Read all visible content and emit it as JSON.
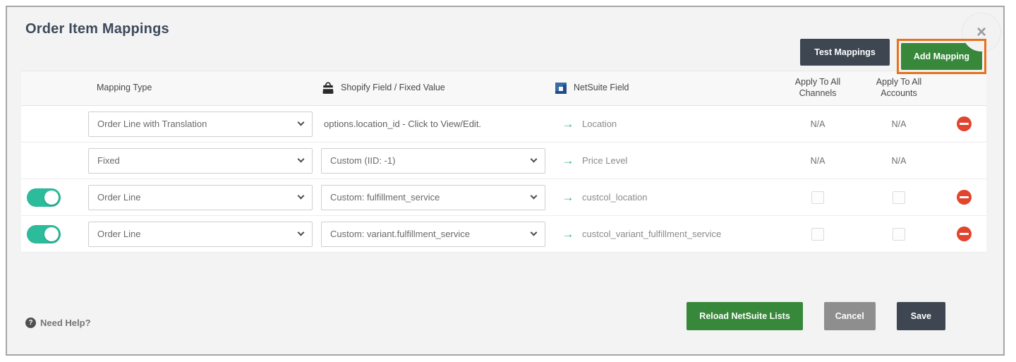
{
  "panel": {
    "title": "Order Item Mappings"
  },
  "toolbar": {
    "test_mappings_label": "Test Mappings",
    "add_mapping_label": "Add Mapping",
    "close_glyph": "×"
  },
  "table": {
    "headers": {
      "mapping_type": "Mapping Type",
      "shopify": "Shopify Field / Fixed Value",
      "netsuite": "NetSuite Field",
      "channels_line1": "Apply To All",
      "channels_line2": "Channels",
      "accounts_line1": "Apply To All",
      "accounts_line2": "Accounts"
    },
    "arrow_glyph": "→",
    "rows": [
      {
        "toggle": "none",
        "mapping_type": "Order Line with Translation",
        "shopify_field": "options.location_id - Click to View/Edit.",
        "shopify_is_select": false,
        "netsuite_field": "Location",
        "channels": "N/A",
        "accounts": "N/A",
        "deletable": true
      },
      {
        "toggle": "none",
        "mapping_type": "Fixed",
        "shopify_field": "Custom (IID: -1)",
        "shopify_is_select": true,
        "netsuite_field": "Price Level",
        "channels": "N/A",
        "accounts": "N/A",
        "deletable": false
      },
      {
        "toggle": "on",
        "mapping_type": "Order Line",
        "shopify_field": "Custom: fulfillment_service",
        "shopify_is_select": true,
        "netsuite_field": "custcol_location",
        "channels": "unchecked",
        "accounts": "unchecked",
        "deletable": true
      },
      {
        "toggle": "on",
        "mapping_type": "Order Line",
        "shopify_field": "Custom: variant.fulfillment_service",
        "shopify_is_select": true,
        "netsuite_field": "custcol_variant_fulfillment_service",
        "channels": "unchecked",
        "accounts": "unchecked",
        "deletable": true
      }
    ]
  },
  "footer": {
    "help_label": "Need Help?",
    "help_icon_glyph": "?",
    "reload_label": "Reload NetSuite Lists",
    "cancel_label": "Cancel",
    "save_label": "Save"
  },
  "icons": {
    "shopify": "shopping-bag-icon",
    "netsuite": "netsuite-logo-icon",
    "help": "question-circle-icon",
    "close": "close-icon",
    "delete": "minus-circle-icon"
  },
  "colors": {
    "accent_green": "#37883a",
    "dark_slate": "#3d4651",
    "cancel_gray": "#8e8e8e",
    "toggle_teal": "#2cbc9c",
    "arrow_teal": "#2cb293",
    "delete_red": "#e2442e",
    "highlight_orange": "#e8711c",
    "title_text": "#3d4a5c",
    "panel_bg": "#f3f3f4"
  }
}
